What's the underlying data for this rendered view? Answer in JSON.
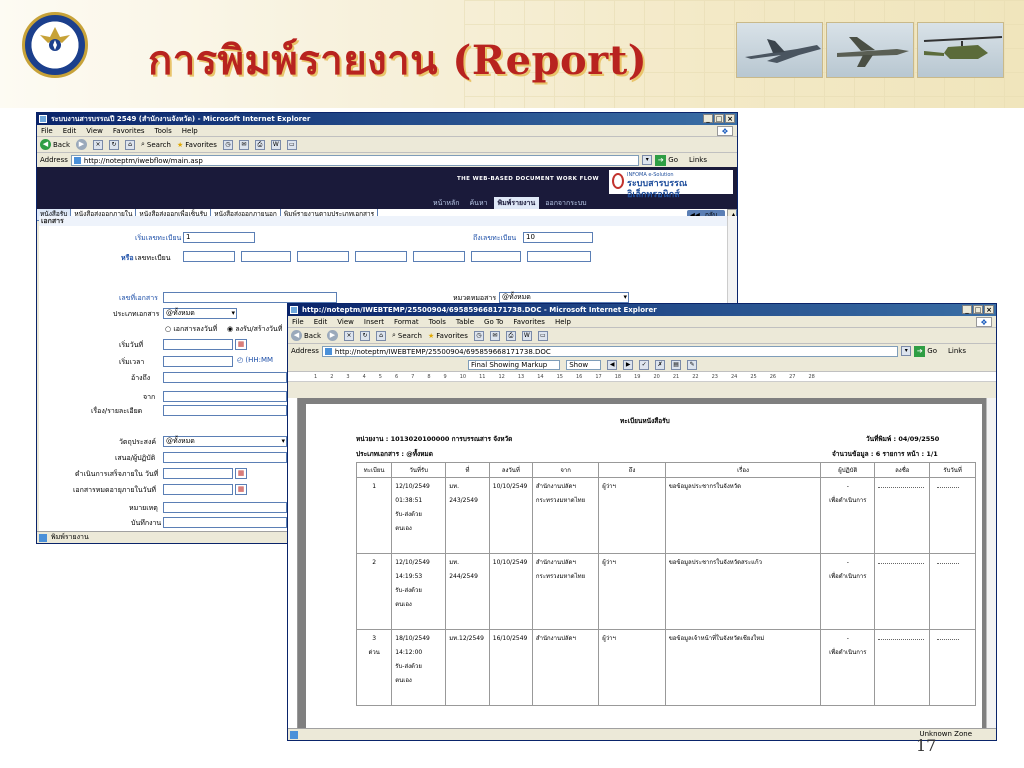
{
  "slide": {
    "title": "การพิมพ์รายงาน (Report)",
    "logo_text": "RTAF",
    "page_number": "17"
  },
  "colors": {
    "title": "#b8231f",
    "title_shadow": "#e9c46a",
    "ie_title": "#0a246a",
    "app_banner": "#1a1a3a",
    "link_blue": "#1d4fa8"
  },
  "win1": {
    "title": "ระบบงานสารบรรณปี 2549 (สำนักงานจังหวัด) - Microsoft Internet Explorer",
    "menu": [
      "File",
      "Edit",
      "View",
      "Favorites",
      "Tools",
      "Help"
    ],
    "toolbar": {
      "back": "Back",
      "search": "Search",
      "favorites": "Favorites"
    },
    "address_label": "Address",
    "address_url": "http://noteptm/iwebflow/main.asp",
    "go": "Go",
    "links": "Links",
    "banner_tag": "THE WEB-BASED DOCUMENT WORK FLOW",
    "brand_small": "INFOMA e-Solution",
    "brand_main": "ระบบสารบรรณอิเล็กทรอนิกส์",
    "nav": [
      "หน้าหลัก",
      "ค้นหา",
      "พิมพ์รายงาน",
      "ออกจากระบบ"
    ],
    "doc_tabs": [
      "หนังสือรับ",
      "หนังสือส่งออกภายใน",
      "หนังสือส่งออกเพื่อเซ็นรับ",
      "หนังสือส่งออกภายนอก",
      "พิมพ์รายงานตามประเภทเอกสาร"
    ],
    "back_button": "กลับ",
    "section": "เอกสาร",
    "form": {
      "start_no_label": "เริ่มเลขทะเบียน",
      "start_no_value": "1",
      "end_no_label": "ถึงเลขทะเบียน",
      "end_no_value": "10",
      "or_label": "หรือ",
      "reg_no_label": "เลขทะเบียน",
      "doc_no_label": "เลขที่เอกสาร",
      "category_label": "หมวดหมอสาร",
      "category_value": "@ทั้งหมด",
      "doc_type_label": "ประเภทเอกสาร",
      "doc_type_value": "@ทั้งหมด",
      "radio1": "เอกสารลงวันที่",
      "radio2": "ลงรับ/สร้างวันที่",
      "date_label": "เริ่มวันที่",
      "time_label": "เริ่มเวลา",
      "time_hint": "(HH:MM",
      "ref_label": "อ้างถึง",
      "from_label": "จาก",
      "subject_label": "เรื่อง/รายละเอียด",
      "purpose_label": "วัตถุประสงค์",
      "purpose_value": "@ทั้งหมด",
      "propose_label": "เสนอ/ผู้ปฏิบัติ",
      "due_label": "ดำเนินการเสร็จภายใน วันที่",
      "expire_label": "เอกสารหมดอายุภายในวันที่",
      "remark_label": "หมายเหตุ",
      "recorder_label": "บันทึกงาน"
    },
    "status": "พิมพ์รายงาน"
  },
  "win2": {
    "title": "http://noteptm/IWEBTEMP/25500904/695859668171738.DOC - Microsoft Internet Explorer",
    "menu": [
      "File",
      "Edit",
      "View",
      "Insert",
      "Format",
      "Tools",
      "Table",
      "Go To",
      "Favorites",
      "Help"
    ],
    "toolbar": {
      "back": "Back",
      "search": "Search",
      "favorites": "Favorites"
    },
    "address_label": "Address",
    "address_url": "http://noteptm/IWEBTEMP/25500904/695859668171738.DOC",
    "go": "Go",
    "links": "Links",
    "markup": "Final Showing Markup",
    "show": "Show",
    "ruler_ticks": [
      "1",
      "2",
      "3",
      "4",
      "5",
      "6",
      "7",
      "8",
      "9",
      "10",
      "11",
      "12",
      "13",
      "14",
      "15",
      "16",
      "17",
      "18",
      "19",
      "20",
      "21",
      "22",
      "23",
      "24",
      "25",
      "26",
      "27",
      "28"
    ],
    "status": "Unknown Zone",
    "report": {
      "title": "ทะเบียนหนังสือรับ",
      "unit": "หน่วยงาน : 1013020100000 การบรรณสาร จังหวัด",
      "print_date": "วันที่พิมพ์ : 04/09/2550",
      "doc_type": "ประเภทเอกสาร : @ทั้งหมด",
      "counts": "จำนวนข้อมูล : 6 รายการ   หน้า : 1/1",
      "headers": [
        "ทะเบียน",
        "วันที่รับ",
        "ที่",
        "ลงวันที่",
        "จาก",
        "ถึง",
        "เรื่อง",
        "ผู้ปฏิบัติ",
        "ลงชื่อ",
        "รับวันที่"
      ],
      "rows": [
        {
          "no": "1",
          "recv": "12/10/2549\n01:38:51\nรับ-ส่งด้วย\nตนเอง",
          "ref": "มท.\n243/2549",
          "dated": "10/10/2549",
          "from": "สำนักงานปลัดฯ\nกระทรวงมหาดไทย",
          "to": "ผู้ว่าฯ",
          "subject": "ขอข้อมูลประชากรในจังหวัด",
          "officer": "-\nเพื่อดำเนินการ"
        },
        {
          "no": "2",
          "recv": "12/10/2549\n14:19:53\nรับ-ส่งด้วย\nตนเอง",
          "ref": "มท.\n244/2549",
          "dated": "10/10/2549",
          "from": "สำนักงานปลัดฯ\nกระทรวงมหาดไทย",
          "to": "ผู้ว่าฯ",
          "subject": "ขอข้อมูลประชากรในจังหวัดสระแก้ว",
          "officer": "-\nเพื่อดำเนินการ"
        },
        {
          "no": "3\nด่วน",
          "recv": "18/10/2549\n14:12:00\nรับ-ส่งด้วย\nตนเอง",
          "ref": "มท.12/2549",
          "dated": "16/10/2549",
          "from": "สำนักงานปลัดฯ",
          "to": "ผู้ว่าฯ",
          "subject": "ขอข้อมูลเจ้าหน้าที่ในจังหวัดเชียงใหม่",
          "officer": "-\nเพื่อดำเนินการ"
        }
      ]
    }
  }
}
